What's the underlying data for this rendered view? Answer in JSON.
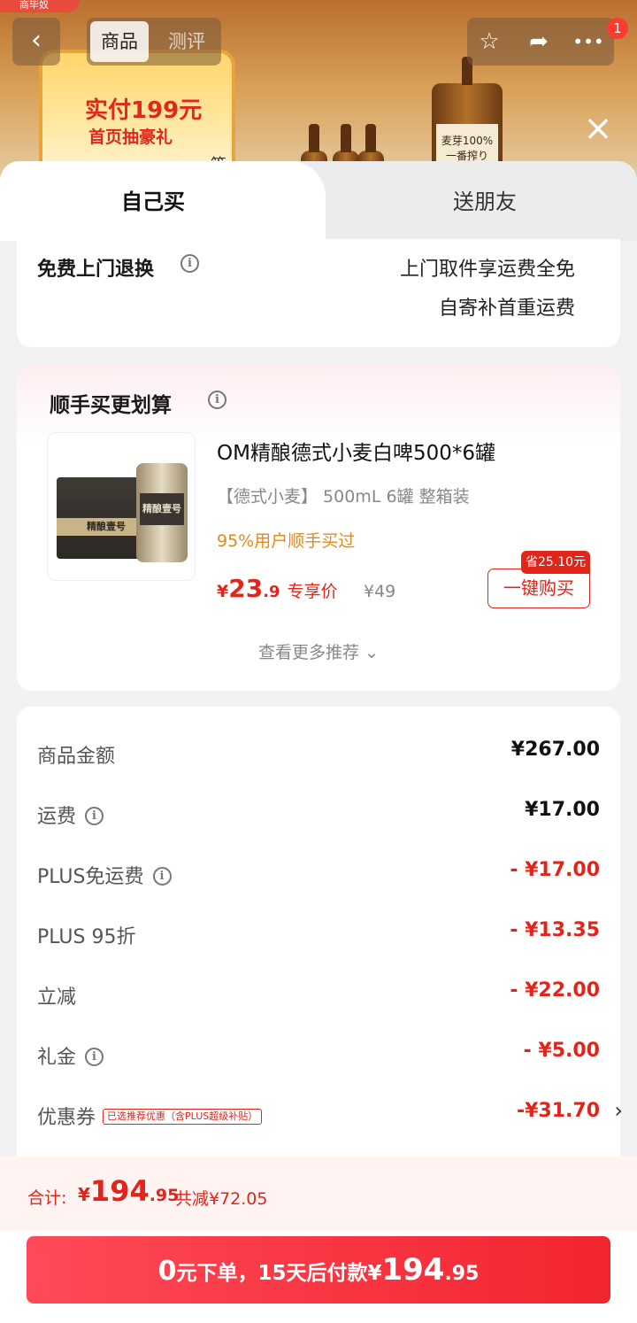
{
  "background": {
    "corner_text": "商毕奴",
    "promo_line1": "实付199元",
    "promo_line2": "首页抽豪礼",
    "promo_line3": "一等奖",
    "bottle_label": "一番搾り",
    "bottle_sublabel": "麦芽100%",
    "tabs": [
      "商品",
      "测评"
    ],
    "badge_count": "1"
  },
  "tabs": {
    "self": "自己买",
    "friend": "送朋友"
  },
  "return_service": {
    "title": "免费上门退换",
    "line1": "上门取件享运费全免",
    "line2": "自寄补首重运费"
  },
  "recommend": {
    "title": "顺手买更划算",
    "product_name": "OM精酿德式小麦白啤500*6罐",
    "spec": "【德式小麦】 500mL 6罐 整箱装",
    "social": "95%用户顺手买过",
    "price_yen": "¥",
    "price_int": "23",
    "price_dec": ".9",
    "price_tag": "专享价",
    "orig_price": "¥49",
    "save_badge": "省25.10元",
    "buy_button": "一键购买",
    "more": "查看更多推荐",
    "box_label": "精酿壹号"
  },
  "summary": {
    "rows": [
      {
        "label": "商品金额",
        "value": "¥267.00"
      },
      {
        "label": "运费",
        "value": "¥17.00"
      },
      {
        "label": "PLUS免运费",
        "value": "- ¥17.00"
      },
      {
        "label": "PLUS 95折",
        "value": "- ¥13.35"
      },
      {
        "label": "立减",
        "value": "- ¥22.00"
      },
      {
        "label": "礼金",
        "value": "- ¥5.00"
      },
      {
        "label": "优惠券",
        "value": "-¥31.70"
      }
    ],
    "coupon_tag": "已选推荐优惠（含PLUS超级补贴）"
  },
  "footer": {
    "total_label": "合计:",
    "total_yen": "¥",
    "total_int": "194",
    "total_dec": ".95",
    "total_saved": "共减¥72.05",
    "btn_a": "0",
    "btn_b": "元下单，15天后付款¥",
    "btn_c": "194",
    "btn_d": ".95"
  },
  "colors": {
    "accent_red": "#e1251b",
    "social_orange": "#e3891a"
  }
}
